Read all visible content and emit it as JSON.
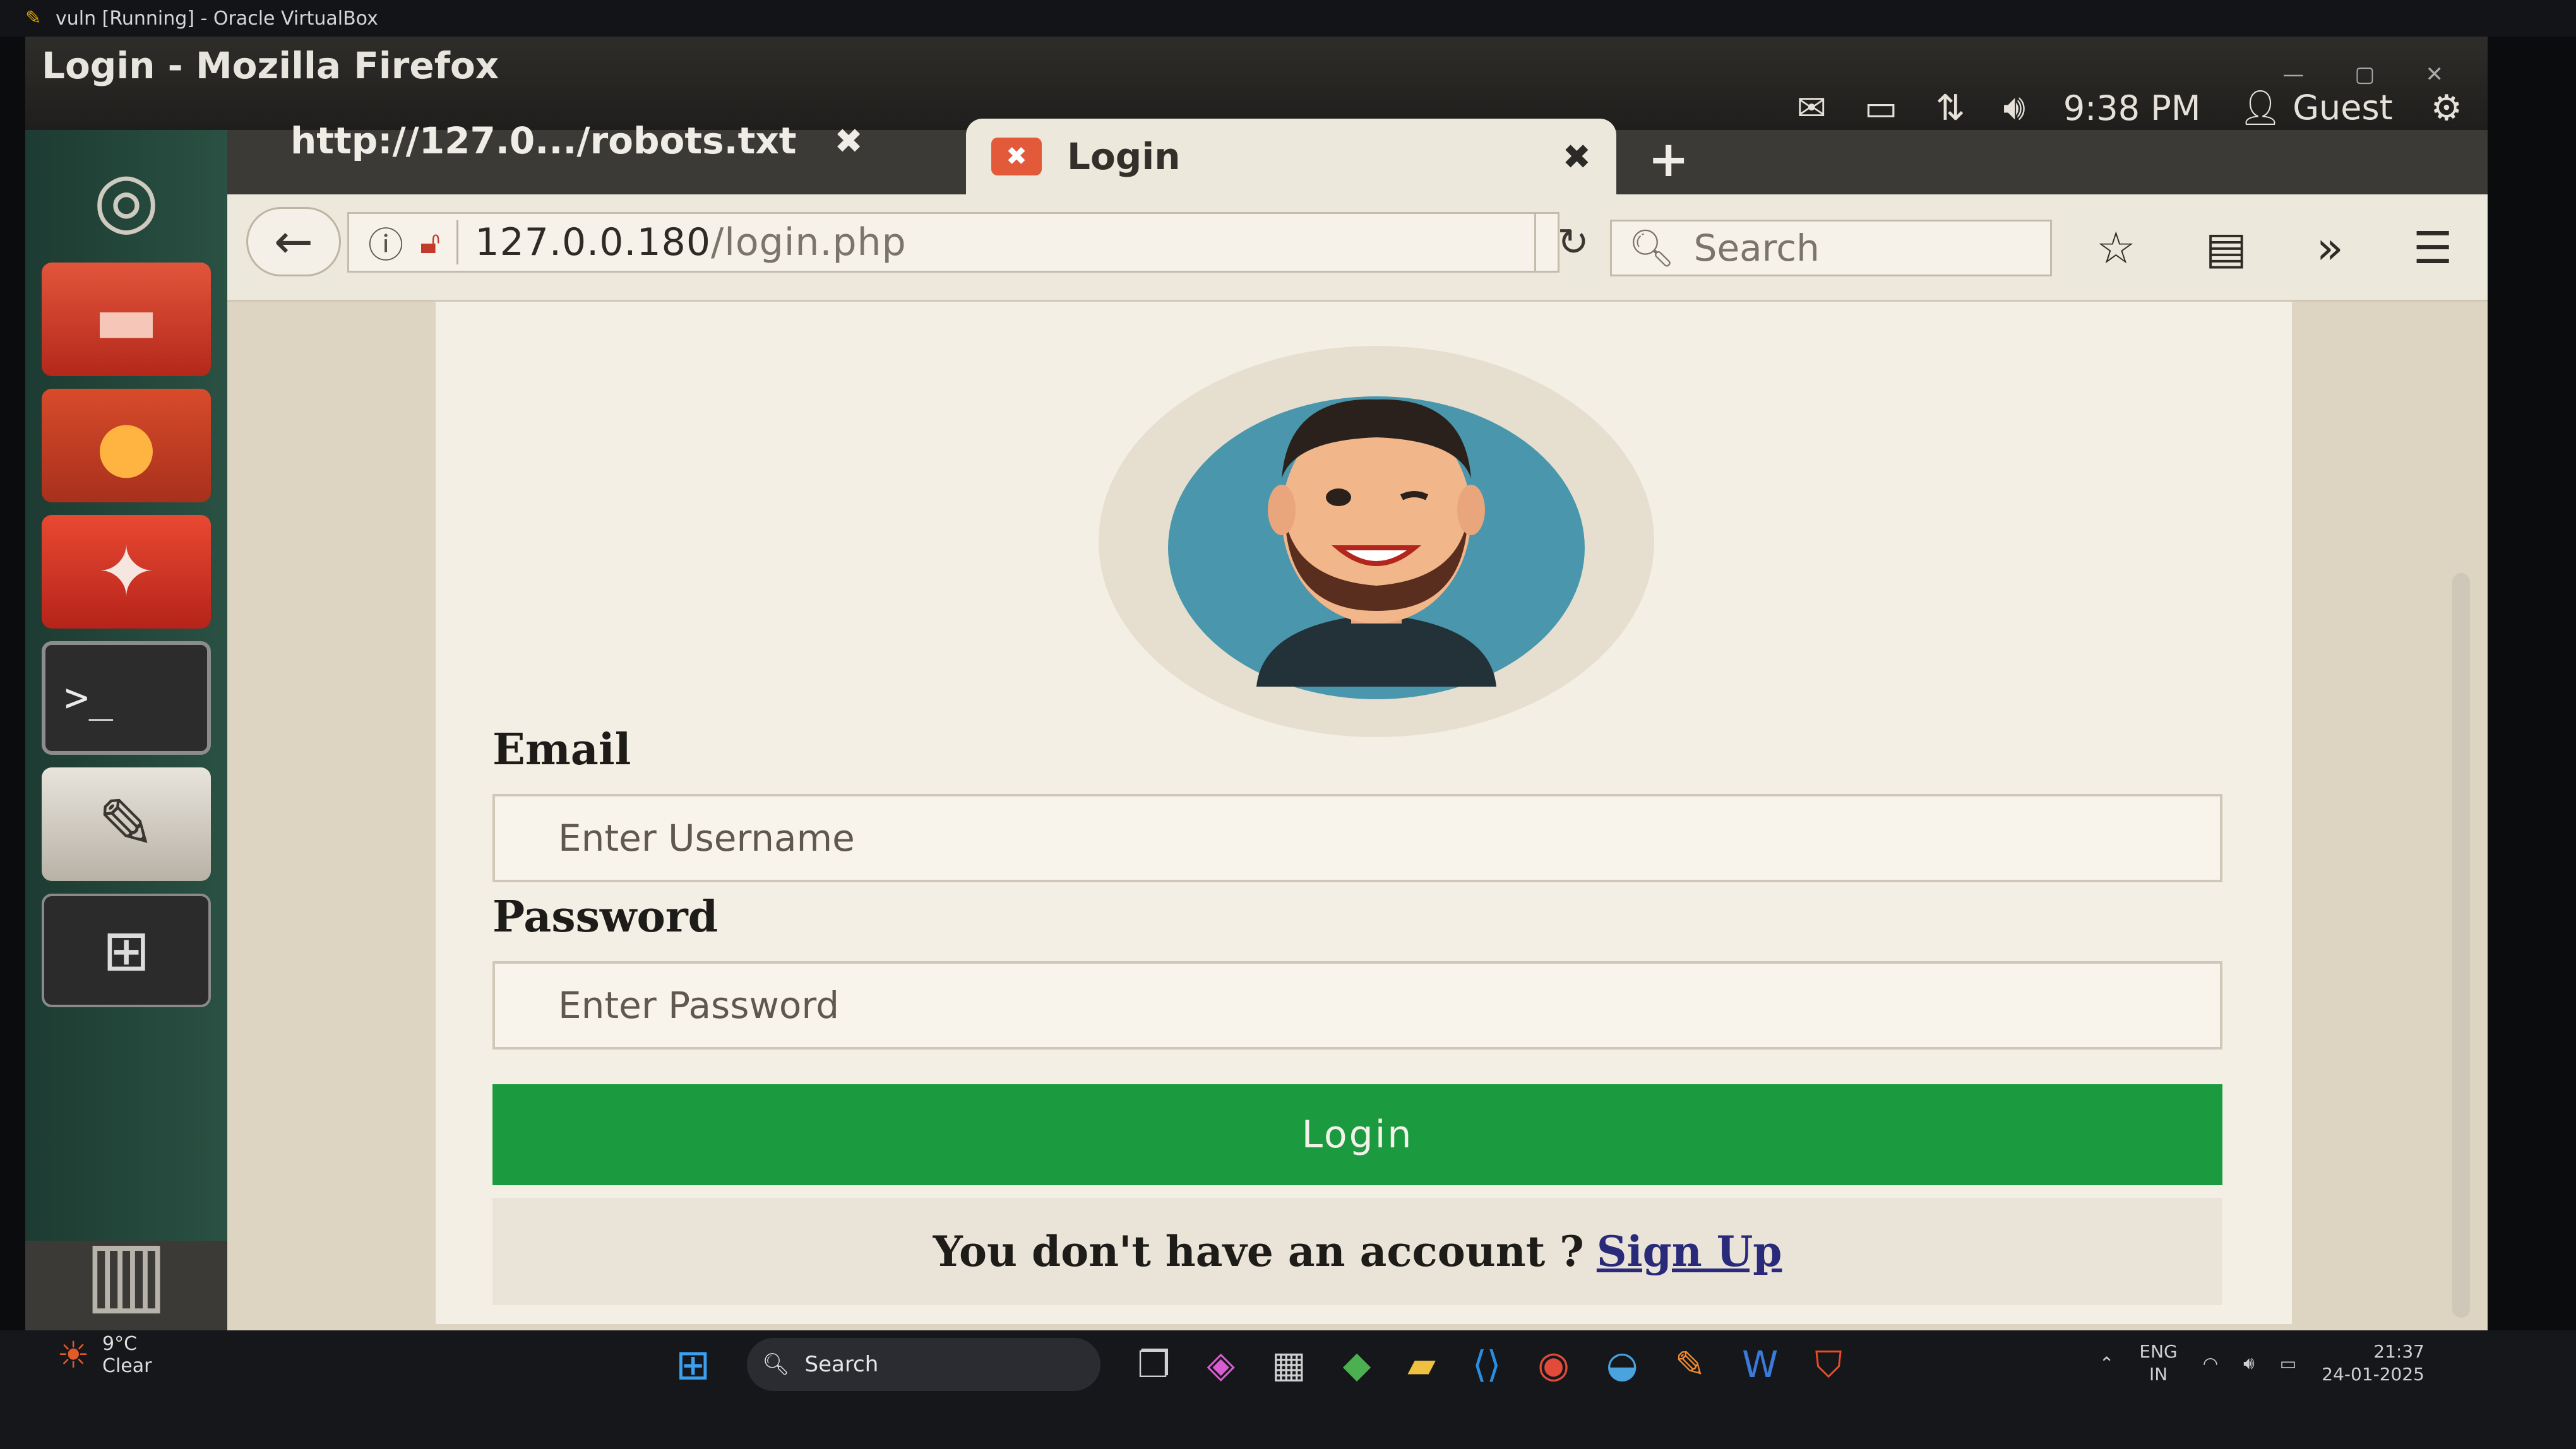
{
  "host": {
    "vbox_title": "vuln [Running] - Oracle VirtualBox"
  },
  "window": {
    "title": "Login - Mozilla Firefox"
  },
  "tray": {
    "time": "9:38 PM",
    "user": "Guest"
  },
  "tabs": [
    {
      "label": "http://127.0.../robots.txt",
      "active": false
    },
    {
      "label": "Login",
      "active": true
    }
  ],
  "navbar": {
    "url_host": "127.0.0.180",
    "url_path": "/login.php",
    "search_placeholder": "Search"
  },
  "form": {
    "email_label": "Email",
    "email_placeholder": "Enter Username",
    "password_label": "Password",
    "password_placeholder": "Enter Password",
    "login_button": "Login",
    "signup_prompt": "You don't have an account ?",
    "signup_link": "Sign Up"
  },
  "taskbar": {
    "weather_temp": "9°C",
    "weather_desc": "Clear",
    "search_label": "Search",
    "lang_top": "ENG",
    "lang_bottom": "IN",
    "clock_time": "21:37",
    "clock_date": "24-01-2025"
  },
  "colors": {
    "login_button": "#1c9a3f",
    "launcher": "#2a5143",
    "page_bg": "#f4efe4"
  }
}
